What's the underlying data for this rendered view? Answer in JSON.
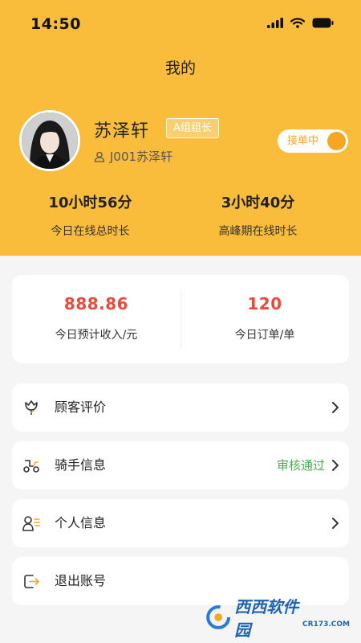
{
  "status_bar": {
    "time": "14:50",
    "icons": [
      "signal-icon",
      "wifi-icon",
      "battery-icon"
    ]
  },
  "nav": {
    "title": "我的"
  },
  "profile": {
    "name": "苏泽轩",
    "role_badge": "A组组长",
    "user_id": "J001苏泽轩",
    "order_toggle": {
      "label": "接单中",
      "on": true
    }
  },
  "stats": [
    {
      "value": "10小时56分",
      "label": "今日在线总时长"
    },
    {
      "value": "3小时40分",
      "label": "高峰期在线时长"
    }
  ],
  "summary": [
    {
      "value": "888.86",
      "label": "今日预计收入/元"
    },
    {
      "value": "120",
      "label": "今日订单/单"
    }
  ],
  "menu": [
    {
      "label": "顾客评价",
      "icon": "flower-icon"
    },
    {
      "label": "骑手信息",
      "icon": "scooter-icon",
      "status": "审核通过"
    },
    {
      "label": "个人信息",
      "icon": "person-list-icon"
    },
    {
      "label": "退出账号",
      "icon": "logout-icon"
    }
  ],
  "watermark": {
    "text": "西西软件园",
    "sub": "CR173.COM"
  },
  "colors": {
    "header_bg": "#f9bc3b",
    "accent_orange": "#f5a623",
    "money_red": "#e84a3d",
    "status_green": "#4caf50"
  }
}
